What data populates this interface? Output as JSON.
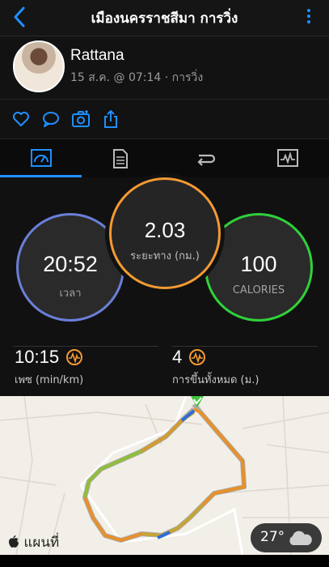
{
  "header": {
    "title": "เมืองนครราชสีมา การวิ่ง"
  },
  "profile": {
    "name": "Rattana",
    "meta": "15 ส.ค. @ 07:14 · การวิ่ง"
  },
  "actions": [
    "heart-icon",
    "comment-icon",
    "camera-icon",
    "share-icon"
  ],
  "tabs": [
    "stats-gauge-icon",
    "document-icon",
    "repeat-icon",
    "activity-graph-icon"
  ],
  "stats": {
    "time": {
      "value": "20:52",
      "label": "เวลา"
    },
    "distance": {
      "value": "2.03",
      "label": "ระยะทาง (กม.)"
    },
    "calories": {
      "value": "100",
      "label": "CALORIES"
    }
  },
  "metrics": {
    "pace": {
      "value": "10:15",
      "label": "เพซ (min/km)"
    },
    "elevation": {
      "value": "4",
      "label": "การขึ้นทั้งหมด (ม.)"
    }
  },
  "map": {
    "label": "แผนที่",
    "temperature": "27°"
  },
  "colors": {
    "accent": "#1e90ff",
    "time_ring": "#6a7fd8",
    "distance_ring": "#f39a33",
    "calories_ring": "#2fd13a"
  }
}
